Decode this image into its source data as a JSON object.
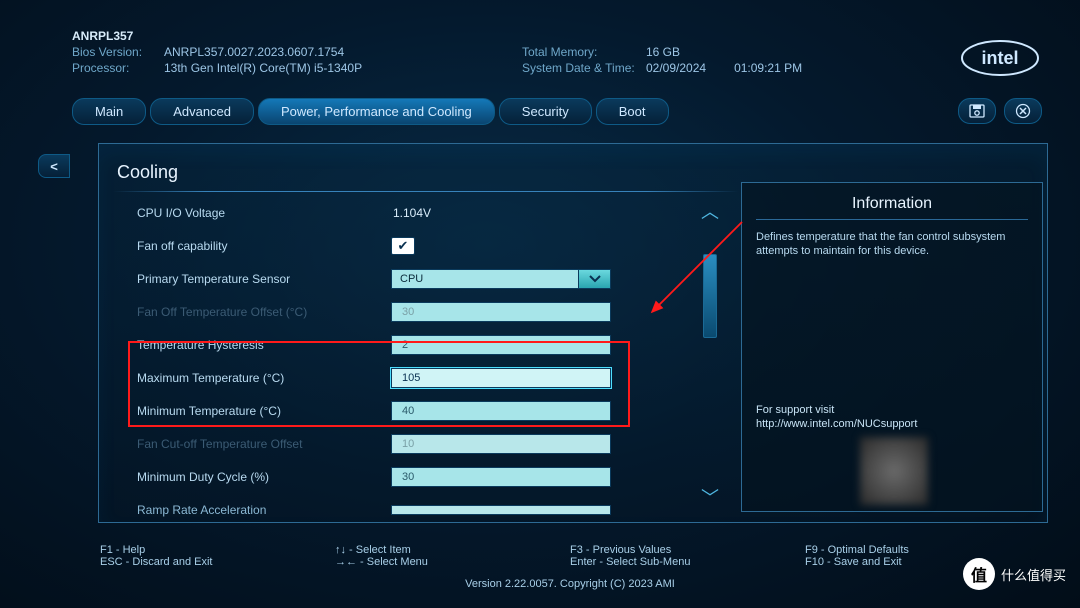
{
  "header": {
    "model": "ANRPL357",
    "bios_version_label": "Bios Version:",
    "bios_version": "ANRPL357.0027.2023.0607.1754",
    "processor_label": "Processor:",
    "processor": "13th Gen Intel(R) Core(TM) i5-1340P",
    "total_memory_label": "Total Memory:",
    "total_memory": "16 GB",
    "datetime_label": "System Date & Time:",
    "date": "02/09/2024",
    "time": "01:09:21 PM"
  },
  "tabs": {
    "main": "Main",
    "advanced": "Advanced",
    "ppc": "Power, Performance and Cooling",
    "security": "Security",
    "boot": "Boot"
  },
  "back": "<",
  "page_title": "Cooling",
  "settings": {
    "cpu_io_voltage_label": "CPU I/O Voltage",
    "cpu_io_voltage": "1.104V",
    "fan_off_capability": "Fan off capability",
    "primary_temp_sensor_label": "Primary Temperature Sensor",
    "primary_temp_sensor": "CPU",
    "fan_off_temp_offset_label": "Fan Off Temperature Offset (°C)",
    "fan_off_temp_offset": "30",
    "temp_hysteresis_label": "Temperature Hysteresis",
    "temp_hysteresis": "2",
    "max_temp_label": "Maximum Temperature (°C)",
    "max_temp": "105",
    "min_temp_label": "Minimum Temperature (°C)",
    "min_temp": "40",
    "fan_cutoff_label": "Fan Cut-off Temperature Offset",
    "fan_cutoff": "10",
    "min_duty_label": "Minimum Duty Cycle (%)",
    "min_duty": "30",
    "ramp_rate_label": "Ramp Rate Acceleration"
  },
  "info": {
    "title": "Information",
    "desc": "Defines temperature that the fan control subsystem attempts to maintain for this device.",
    "support1": "For support visit",
    "support2": "http://www.intel.com/NUCsupport"
  },
  "footer": {
    "f1": "F1 - Help",
    "esc": "ESC - Discard and Exit",
    "updown": "↑↓ - Select Item",
    "leftright": "→← - Select Menu",
    "f3": "F3 - Previous Values",
    "enter": "Enter - Select Sub-Menu",
    "f9": "F9 - Optimal Defaults",
    "f10": "F10 - Save and Exit",
    "copy": "Version 2.22.0057. Copyright (C) 2023 AMI"
  },
  "watermark": {
    "badge": "值",
    "text": "什么值得买"
  }
}
